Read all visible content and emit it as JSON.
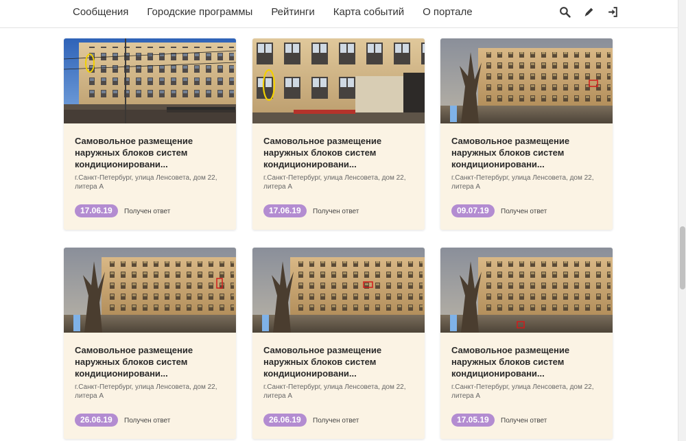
{
  "nav": {
    "items": [
      {
        "label": "Сообщения"
      },
      {
        "label": "Городские программы"
      },
      {
        "label": "Рейтинги"
      },
      {
        "label": "Карта событий"
      },
      {
        "label": "О портале"
      }
    ],
    "icons": [
      "search-icon",
      "pencil-icon",
      "sign-in-icon"
    ]
  },
  "cards": [
    {
      "title": "Самовольное размещение наружных блоков систем кондиционировани...",
      "address": "г.Санкт-Петербург, улица Ленсовета, дом 22, литера А",
      "date": "17.06.19",
      "status": "Получен ответ",
      "photo": "street-daytime-blue-sky"
    },
    {
      "title": "Самовольное размещение наружных блоков систем кондиционировани...",
      "address": "г.Санкт-Петербург, улица Ленсовета, дом 22, литера А",
      "date": "17.06.19",
      "status": "Получен ответ",
      "photo": "facade-closeup"
    },
    {
      "title": "Самовольное размещение наружных блоков систем кондиционировани...",
      "address": "г.Санкт-Петербург, улица Ленсовета, дом 22, литера А",
      "date": "09.07.19",
      "status": "Получен ответ",
      "photo": "building-evening"
    },
    {
      "title": "Самовольное размещение наружных блоков систем кондиционировани...",
      "address": "г.Санкт-Петербург, улица Ленсовета, дом 22, литера А",
      "date": "26.06.19",
      "status": "Получен ответ",
      "photo": "building-evening"
    },
    {
      "title": "Самовольное размещение наружных блоков систем кондиционировани...",
      "address": "г.Санкт-Петербург, улица Ленсовета, дом 22, литера А",
      "date": "26.06.19",
      "status": "Получен ответ",
      "photo": "building-evening"
    },
    {
      "title": "Самовольное размещение наружных блоков систем кондиционировани...",
      "address": "г.Санкт-Петербург, улица Ленсовета, дом 22, литера А",
      "date": "17.05.19",
      "status": "Получен ответ",
      "photo": "building-evening"
    }
  ],
  "colors": {
    "card_bg": "#fbf3e4",
    "date_badge": "#b38cd1",
    "highlight_ellipse": "#f2d000",
    "highlight_box": "#d11a1a"
  }
}
